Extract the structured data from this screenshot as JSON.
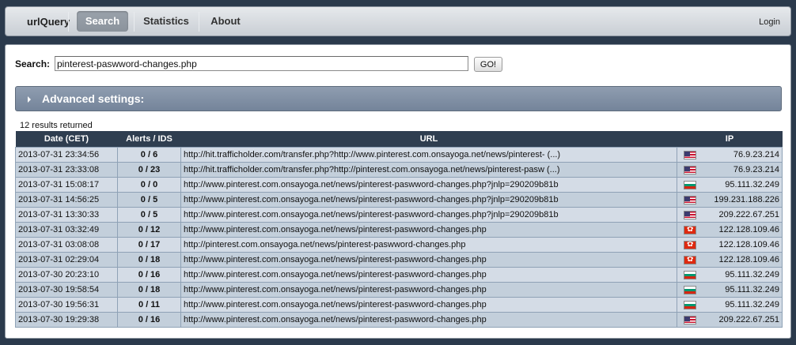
{
  "nav": {
    "brand": "urlQuery",
    "tabs": [
      "Search",
      "Statistics",
      "About"
    ],
    "active_tab": "Search",
    "login": "Login"
  },
  "search": {
    "label": "Search:",
    "value": "pinterest-paswword-changes.php",
    "button": "GO!"
  },
  "advanced": {
    "label": "Advanced settings:",
    "icon": "triangle-right-icon"
  },
  "results": {
    "count_text": "12 results returned",
    "columns": [
      "Date (CET)",
      "Alerts / IDS",
      "URL",
      "IP"
    ],
    "rows": [
      {
        "date": "2013-07-31 23:34:56",
        "alerts": "0 / 6",
        "url": "http://hit.trafficholder.com/transfer.php?http://www.pinterest.com.onsayoga.net/news/pinterest- (...)",
        "flag": "us",
        "ip": "76.9.23.214"
      },
      {
        "date": "2013-07-31 23:33:08",
        "alerts": "0 / 23",
        "url": "http://hit.trafficholder.com/transfer.php?http://pinterest.com.onsayoga.net/news/pinterest-pasw (...)",
        "flag": "us",
        "ip": "76.9.23.214"
      },
      {
        "date": "2013-07-31 15:08:17",
        "alerts": "0 / 0",
        "url": "http://www.pinterest.com.onsayoga.net/news/pinterest-paswword-changes.php?jnlp=290209b81b",
        "flag": "bg",
        "ip": "95.111.32.249"
      },
      {
        "date": "2013-07-31 14:56:25",
        "alerts": "0 / 5",
        "url": "http://www.pinterest.com.onsayoga.net/news/pinterest-paswword-changes.php?jnlp=290209b81b",
        "flag": "us",
        "ip": "199.231.188.226"
      },
      {
        "date": "2013-07-31 13:30:33",
        "alerts": "0 / 5",
        "url": "http://www.pinterest.com.onsayoga.net/news/pinterest-paswword-changes.php?jnlp=290209b81b",
        "flag": "us",
        "ip": "209.222.67.251"
      },
      {
        "date": "2013-07-31 03:32:49",
        "alerts": "0 / 12",
        "url": "http://www.pinterest.com.onsayoga.net/news/pinterest-paswword-changes.php",
        "flag": "hk",
        "ip": "122.128.109.46"
      },
      {
        "date": "2013-07-31 03:08:08",
        "alerts": "0 / 17",
        "url": "http://pinterest.com.onsayoga.net/news/pinterest-paswword-changes.php",
        "flag": "hk",
        "ip": "122.128.109.46"
      },
      {
        "date": "2013-07-31 02:29:04",
        "alerts": "0 / 18",
        "url": "http://www.pinterest.com.onsayoga.net/news/pinterest-paswword-changes.php",
        "flag": "hk",
        "ip": "122.128.109.46"
      },
      {
        "date": "2013-07-30 20:23:10",
        "alerts": "0 / 16",
        "url": "http://www.pinterest.com.onsayoga.net/news/pinterest-paswword-changes.php",
        "flag": "bg",
        "ip": "95.111.32.249"
      },
      {
        "date": "2013-07-30 19:58:54",
        "alerts": "0 / 18",
        "url": "http://www.pinterest.com.onsayoga.net/news/pinterest-paswword-changes.php",
        "flag": "bg",
        "ip": "95.111.32.249"
      },
      {
        "date": "2013-07-30 19:56:31",
        "alerts": "0 / 11",
        "url": "http://www.pinterest.com.onsayoga.net/news/pinterest-paswword-changes.php",
        "flag": "bg",
        "ip": "95.111.32.249"
      },
      {
        "date": "2013-07-30 19:29:38",
        "alerts": "0 / 16",
        "url": "http://www.pinterest.com.onsayoga.net/news/pinterest-paswword-changes.php",
        "flag": "us",
        "ip": "209.222.67.251"
      }
    ]
  }
}
